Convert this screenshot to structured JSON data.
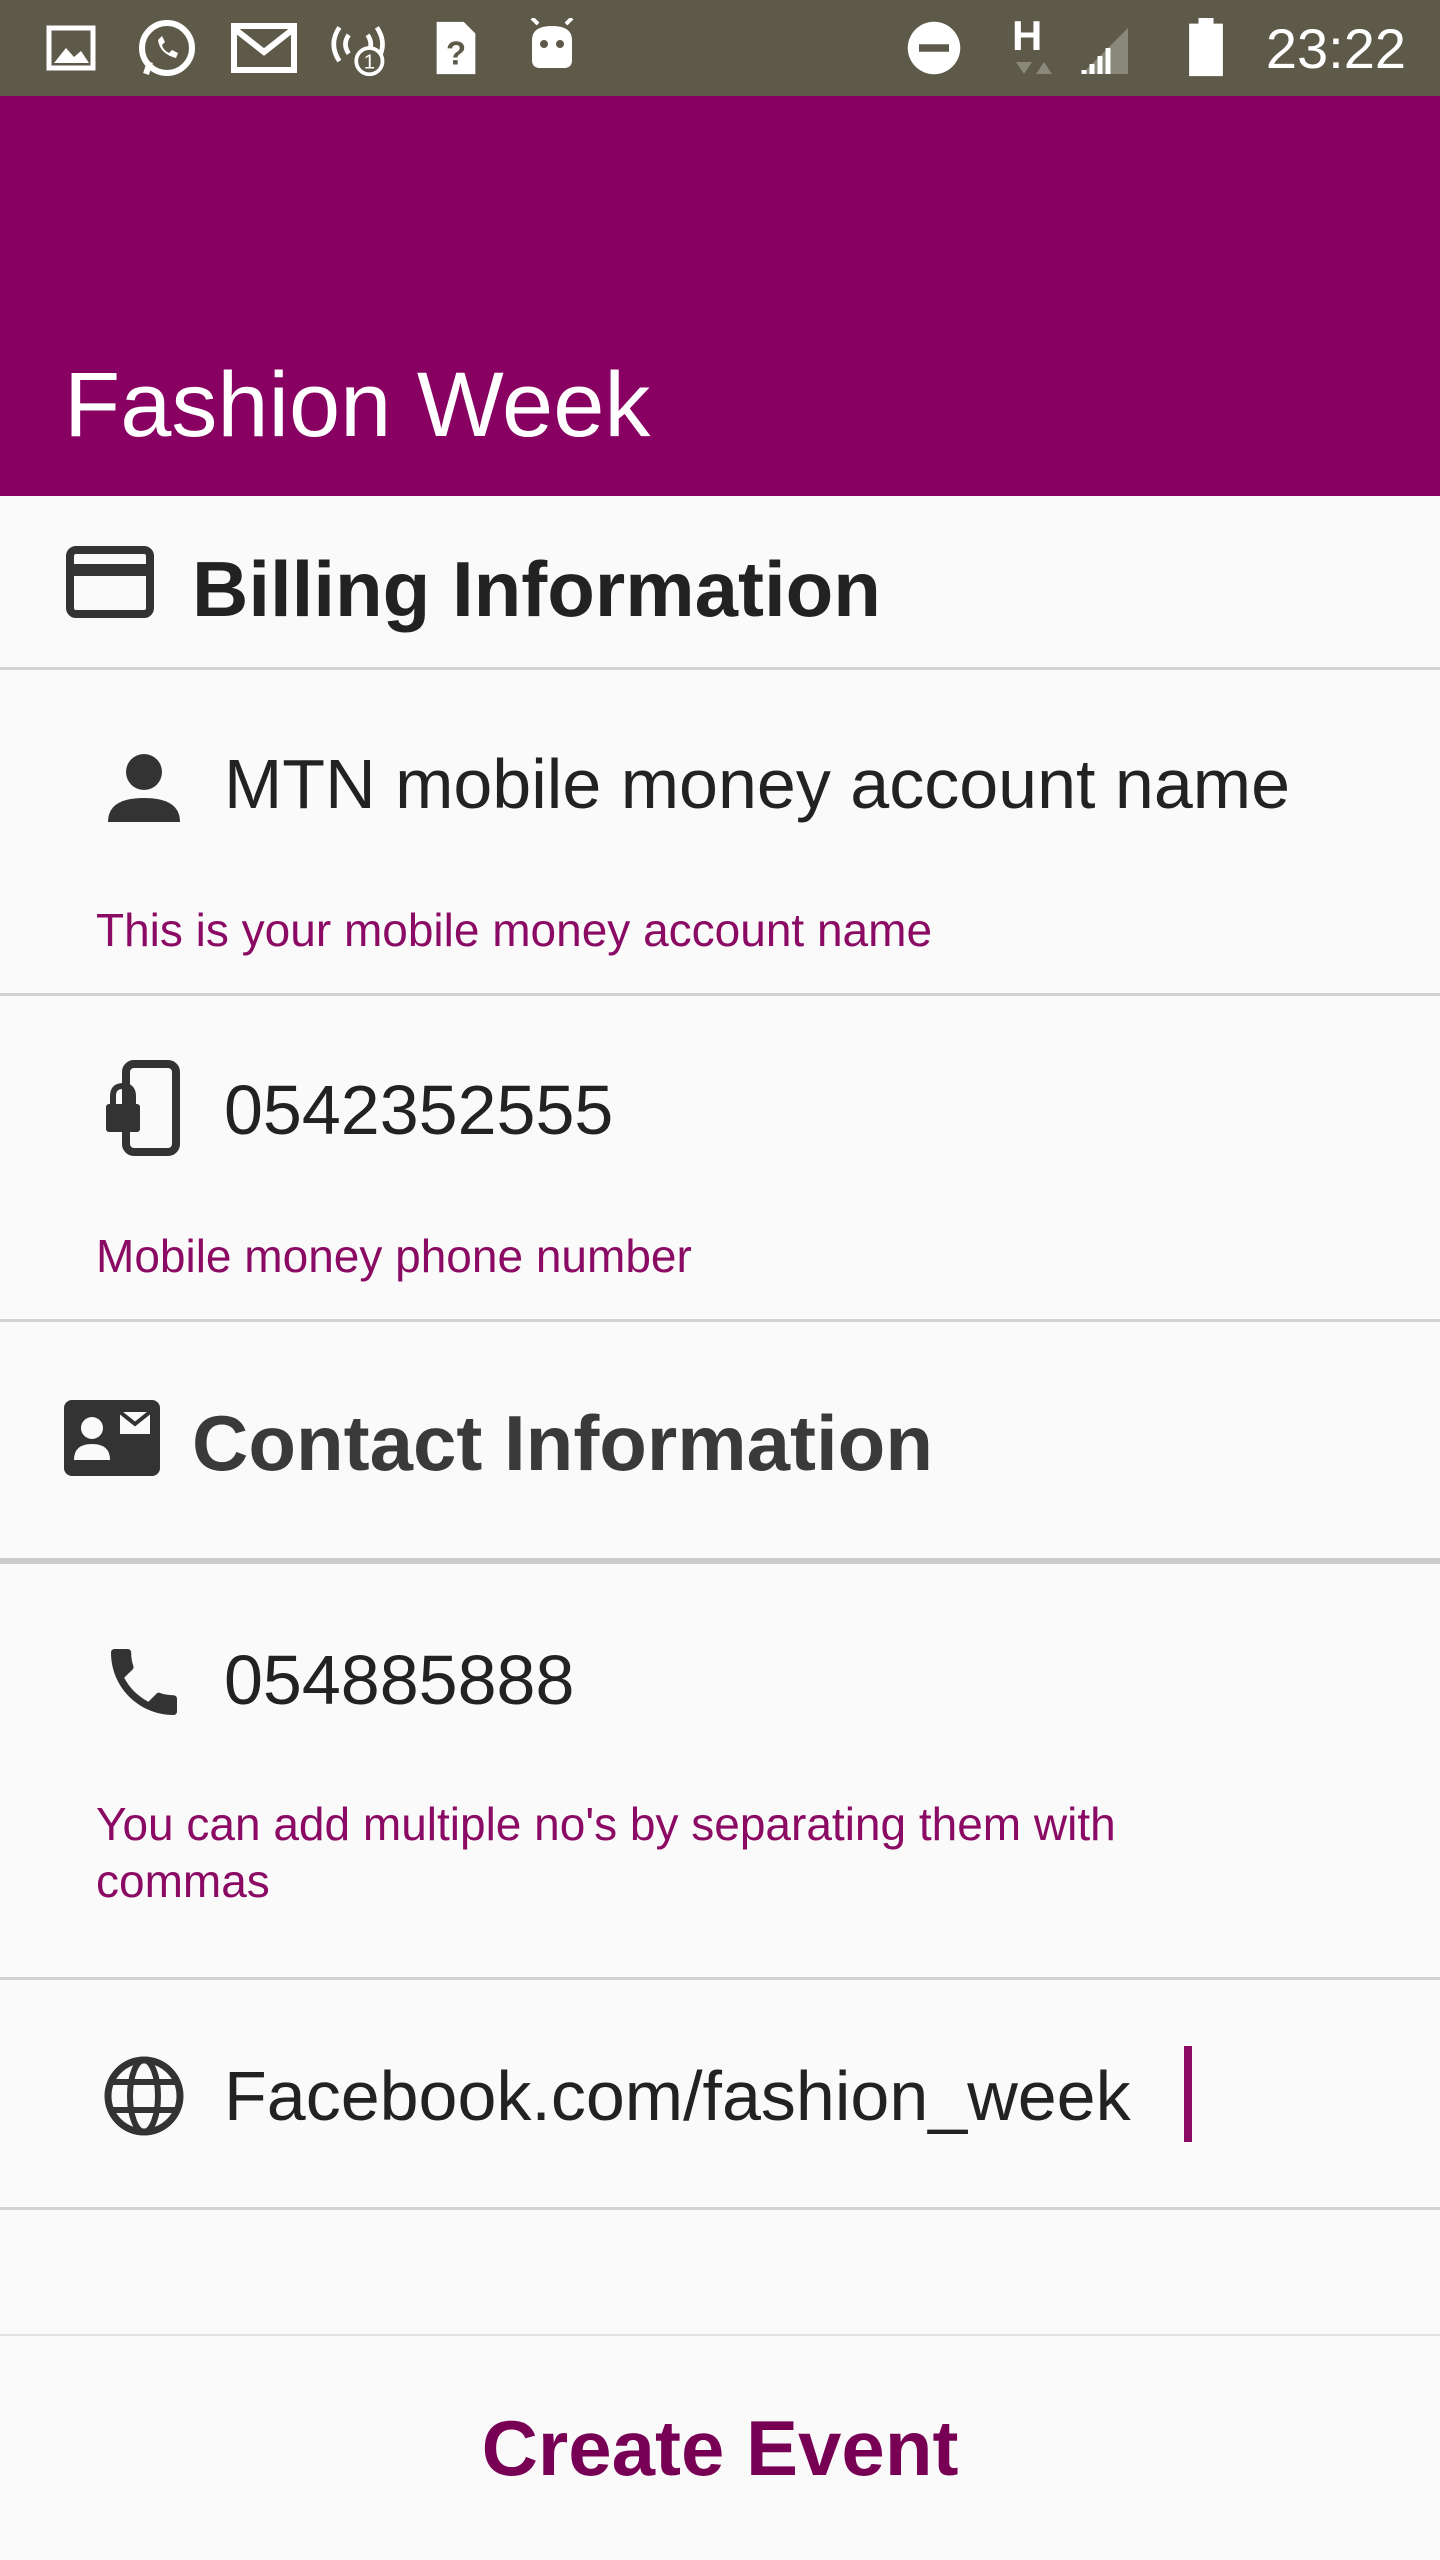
{
  "status_bar": {
    "time": "23:22",
    "network_label": "H",
    "icons": [
      "image-icon",
      "whatsapp-icon",
      "gmail-icon",
      "hotspot-icon",
      "sim-unknown-icon",
      "android-icon",
      "do-not-disturb-icon",
      "data-h-icon",
      "signal-icon",
      "battery-icon"
    ]
  },
  "app_bar": {
    "title": "Fashion Week"
  },
  "billing": {
    "header": "Billing Information",
    "account_name": {
      "value": "MTN mobile money account name",
      "hint": "This is your mobile money account name"
    },
    "phone": {
      "value": "0542352555",
      "hint": "Mobile money phone number"
    }
  },
  "contact": {
    "header": "Contact Information",
    "phone": {
      "value": "054885888",
      "hint": "You can add multiple no's by separating them with commas"
    },
    "website": {
      "value": "Facebook.com/fashion_week"
    }
  },
  "actions": {
    "create_event": "Create Event"
  },
  "colors": {
    "primary": "#880061",
    "accent": "#8a0a64",
    "status_bar": "#5e5a4a"
  }
}
